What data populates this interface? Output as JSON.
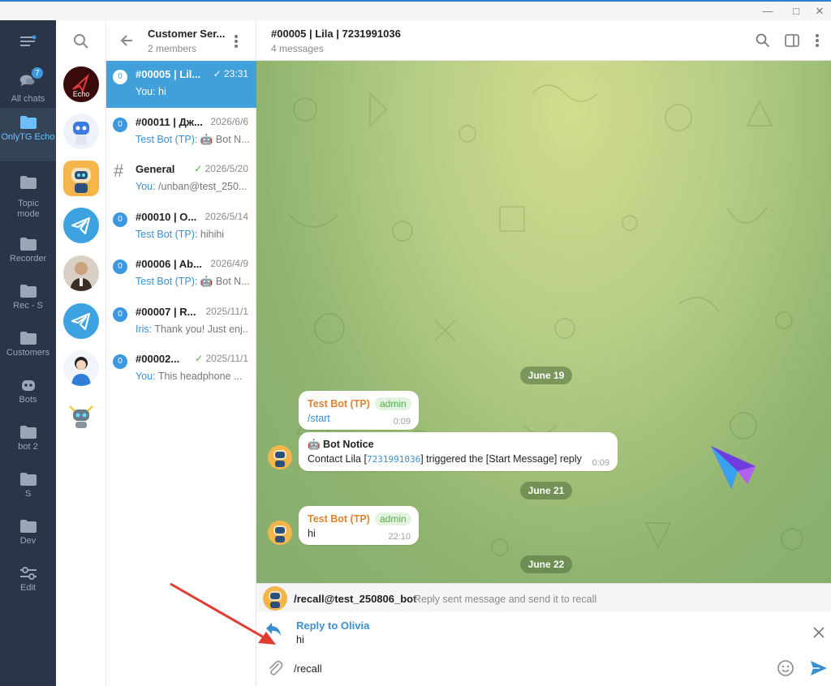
{
  "folders": [
    {
      "label": "All chats",
      "icon": "chats-icon"
    },
    {
      "label": "OnlyTG Echo",
      "icon": "folder-icon"
    },
    {
      "label": "Topic mode",
      "icon": "folder-icon"
    },
    {
      "label": "Recorder",
      "icon": "folder-icon"
    },
    {
      "label": "Rec - S",
      "icon": "folder-icon"
    },
    {
      "label": "Customers",
      "icon": "folder-icon"
    },
    {
      "label": "Bots",
      "icon": "bot-icon"
    },
    {
      "label": "bot 2",
      "icon": "folder-icon"
    },
    {
      "label": "S",
      "icon": "folder-icon"
    },
    {
      "label": "Dev",
      "icon": "folder-icon"
    },
    {
      "label": "Edit",
      "icon": "edit-icon"
    }
  ],
  "all_chats_badge": "7",
  "group": {
    "title": "Customer Ser...",
    "members": "2 members"
  },
  "chats": [
    {
      "badge": "0",
      "title": "#00005 | Lil...",
      "time": "23:31",
      "sender": "You: ",
      "preview": "hi",
      "check": true
    },
    {
      "badge": "0",
      "title": "#00011 | Дж...",
      "time": "2026/6/6",
      "sender": "Test Bot (TP): ",
      "preview": "🤖 Bot N...",
      "check": false
    },
    {
      "badge": "#",
      "title": "General",
      "time": "2026/5/20",
      "sender": "You: ",
      "preview": "/unban@test_250...",
      "check": true
    },
    {
      "badge": "0",
      "title": "#00010 | O...",
      "time": "2026/5/14",
      "sender": "Test Bot (TP): ",
      "preview": "hihihi",
      "check": false
    },
    {
      "badge": "0",
      "title": "#00006 | Ab...",
      "time": "2026/4/9",
      "sender": "Test Bot (TP): ",
      "preview": "🤖 Bot N...",
      "check": false
    },
    {
      "badge": "0",
      "title": "#00007 | R...",
      "time": "2025/11/1",
      "sender": "Iris: ",
      "preview": "Thank you! Just enj...",
      "check": false
    },
    {
      "badge": "0",
      "title": "#00002...",
      "time": "2025/11/1",
      "sender": "You: ",
      "preview": "This headphone ...",
      "check": true
    }
  ],
  "avatar_text": "Echo",
  "header": {
    "title": "#00005 | Lila | 7231991036",
    "subtitle": "4 messages"
  },
  "dates": [
    "June 19",
    "June 21",
    "June 22"
  ],
  "messages": {
    "m1": {
      "sender": "Test Bot (TP)",
      "role": "admin",
      "text": "/start",
      "time": "0:09"
    },
    "m2": {
      "title": "🤖 Bot Notice",
      "text_a": "Contact Lila [",
      "code": "7231991036",
      "text_b": "]  triggered the [Start Message] reply",
      "time": "0:09"
    },
    "m3": {
      "sender": "Test Bot (TP)",
      "role": "admin",
      "text": "hi",
      "time": "22:10"
    }
  },
  "command": {
    "name": "/recall@test_250806_bot",
    "desc": "Reply sent message and send it to recall"
  },
  "reply": {
    "label": "Reply to Olivia",
    "text": "hi"
  },
  "composer": {
    "value": "/recall"
  },
  "colors": {
    "accent": "#419fd9",
    "sidebar": "#2a3647",
    "admin_badge": "#56ab4c",
    "sender_name": "#e0832f"
  }
}
